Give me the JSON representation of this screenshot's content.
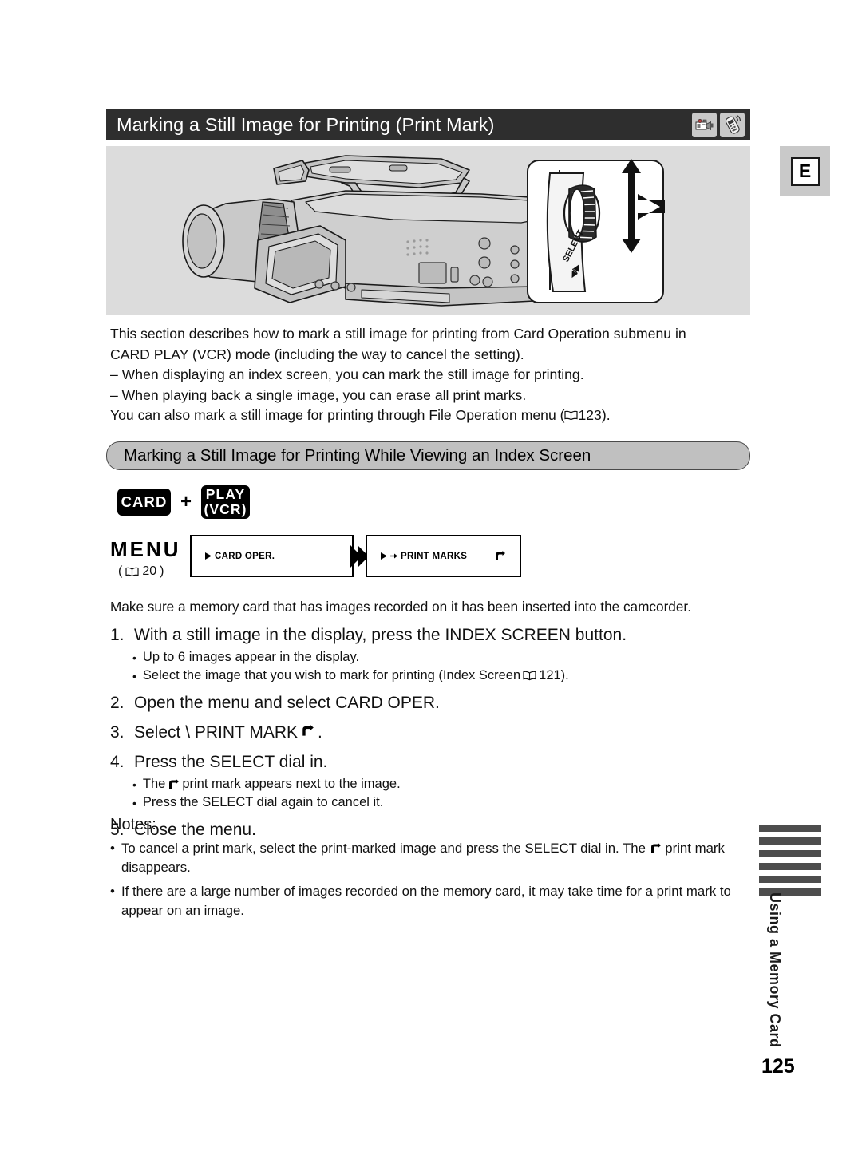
{
  "header": {
    "title": "Marking a Still Image for Printing (Print Mark)",
    "icons": [
      {
        "name": "camcorder-icon",
        "label": "camcorder"
      },
      {
        "name": "remote-control-icon",
        "label": "remote control"
      }
    ]
  },
  "edition_tab": {
    "label": "E"
  },
  "illustration": {
    "caption_dial_label": "SELECT",
    "alt": "Camcorder with LCD panel open; callout detail of the SELECT dial showing turn and press directions"
  },
  "intro": {
    "lines": [
      "This section describes how to mark a still image for printing from Card Operation submenu in",
      "CARD PLAY (VCR) mode (including the way to cancel the setting).",
      "– When displaying an index screen, you can mark the still image for printing.",
      "– When playing back a single image, you can erase all print marks."
    ],
    "last_line_prefix": "You can also mark a still image for printing through File Operation menu (",
    "last_line_page": "123",
    "last_line_suffix": ")."
  },
  "section": {
    "heading": "Marking a Still Image for Printing While Viewing an Index Screen"
  },
  "mode_badges": {
    "card": "CARD",
    "plus": "+",
    "play_line1": "PLAY",
    "play_line2": "(VCR)"
  },
  "menu_flow": {
    "menu_label": "MENU",
    "menu_ref_open": "(",
    "menu_ref_page": "20",
    "menu_ref_close": ")",
    "box1": "CARD OPER.",
    "box2": "PRINT MARKS"
  },
  "instructions": {
    "preamble": "Make sure a memory card that has images recorded on it has been inserted into the camcorder.",
    "steps": [
      {
        "num": "1.",
        "text": "With a still image in the display, press the INDEX SCREEN button.",
        "bullets": [
          {
            "text": "Up to 6 images appear in the display."
          },
          {
            "text_before": "Select the image that you wish to mark for printing (Index Screen ",
            "page": "121",
            "text_after": ")."
          }
        ]
      },
      {
        "num": "2.",
        "text": "Open the menu and select CARD OPER.",
        "bullets": []
      },
      {
        "num": "3.",
        "text": "Select \\   PRINT MARK",
        "text_after_glyph": ".",
        "bullets": []
      },
      {
        "num": "4.",
        "text": "Press the SELECT dial in.",
        "bullets": [
          {
            "text_before": "The ",
            "text_after": " print mark appears next to the image.",
            "has_glyph": true
          },
          {
            "text": "Press the SELECT dial again to cancel it."
          }
        ]
      },
      {
        "num": "5.",
        "text": "Close the menu.",
        "bullets": []
      }
    ]
  },
  "notes": {
    "title": "Notes:",
    "items": [
      {
        "before": "To cancel a print mark, select the print-marked image and press the SELECT dial in. The ",
        "after": " print mark disappears.",
        "has_glyph": true
      },
      {
        "before": "If there are a large number of images recorded on the memory card, it may take time for a print mark to appear on an image.",
        "after": "",
        "has_glyph": false
      }
    ]
  },
  "side_tab": {
    "label": "Using a Memory Card",
    "bar_count": 6
  },
  "page_number": "125",
  "colors": {
    "title_bar": "#2e2e2e",
    "panel_gray": "#dcdcdc",
    "section_gray": "#c0c0c0",
    "badge_black": "#000000",
    "side_bar_gray": "#4d4d4d"
  }
}
